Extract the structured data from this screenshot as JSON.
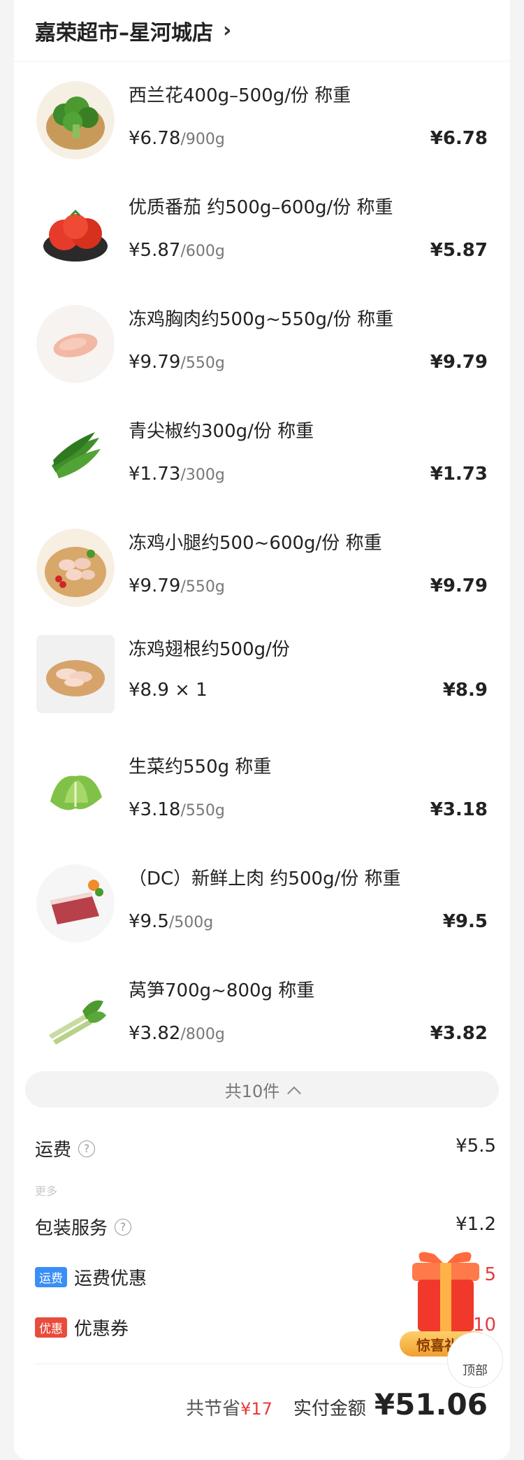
{
  "store": {
    "name": "嘉荣超市–星河城店",
    "chevron": "›"
  },
  "items": [
    {
      "name": "西兰花400g–500g/份 称重",
      "price": "¥6.78",
      "unit": "/900g",
      "total": "¥6.78",
      "icon": "broccoli-icon"
    },
    {
      "name": "优质番茄 约500g–600g/份 称重",
      "price": "¥5.87",
      "unit": "/600g",
      "total": "¥5.87",
      "icon": "tomato-icon"
    },
    {
      "name": "冻鸡胸肉约500g~550g/份 称重",
      "price": "¥9.79",
      "unit": "/550g",
      "total": "¥9.79",
      "icon": "chicken-breast-icon"
    },
    {
      "name": "青尖椒约300g/份 称重",
      "price": "¥1.73",
      "unit": "/300g",
      "total": "¥1.73",
      "icon": "green-pepper-icon"
    },
    {
      "name": "冻鸡小腿约500~600g/份 称重",
      "price": "¥9.79",
      "unit": "/550g",
      "total": "¥9.79",
      "icon": "chicken-drumstick-icon"
    },
    {
      "name": "冻鸡翅根约500g/份",
      "price": "¥8.9 × 1",
      "unit": "",
      "total": "¥8.9",
      "icon": "chicken-wing-icon"
    },
    {
      "name": "生菜约550g 称重",
      "price": "¥3.18",
      "unit": "/550g",
      "total": "¥3.18",
      "icon": "lettuce-icon"
    },
    {
      "name": "（DC）新鲜上肉 约500g/份 称重",
      "price": "¥9.5",
      "unit": "/500g",
      "total": "¥9.5",
      "icon": "pork-icon"
    },
    {
      "name": "莴笋700g~800g 称重",
      "price": "¥3.82",
      "unit": "/800g",
      "total": "¥3.82",
      "icon": "lettuce-stem-icon"
    }
  ],
  "count_label": "共10件",
  "fees": {
    "shipping_label": "运费",
    "shipping_value": "¥5.5",
    "more_label": "更多",
    "packing_label": "包装服务",
    "packing_value": "¥1.2",
    "shipping_discount_tag": "运费",
    "shipping_discount_label": "运费优惠",
    "shipping_discount_value": "5",
    "coupon_tag": "优惠",
    "coupon_label": "优惠券",
    "coupon_value": "10"
  },
  "summary": {
    "save_label": "共节省",
    "save_value": "¥17",
    "pay_label": "实付金额",
    "pay_value": "¥51.06"
  },
  "gift": {
    "label": "惊喜礼盒"
  },
  "top_button": {
    "label": "顶部"
  },
  "colors": {
    "accent_red": "#e8393c",
    "tag_blue": "#3a8ef6",
    "tag_red": "#e84c3d"
  }
}
